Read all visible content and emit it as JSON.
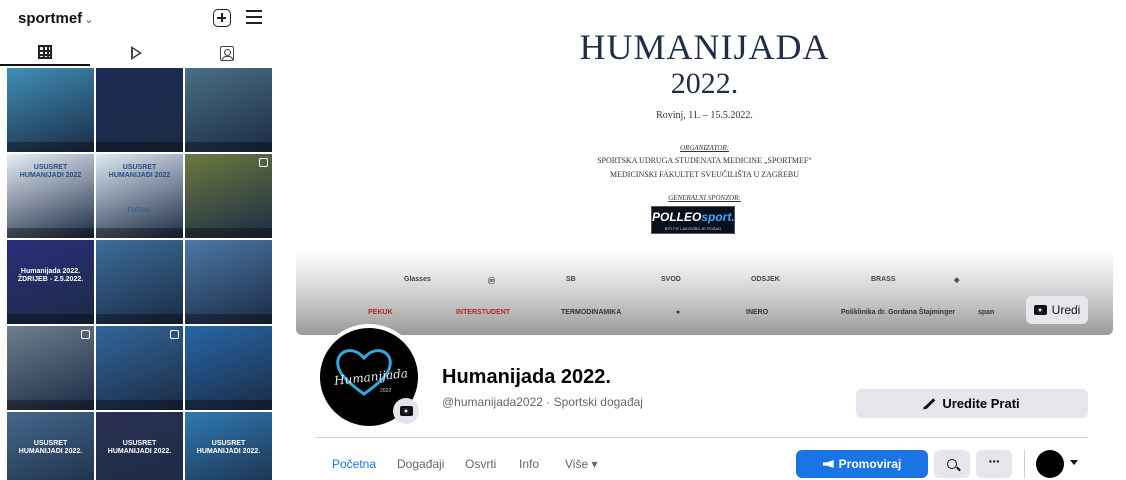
{
  "instagram": {
    "username": "sportmef",
    "username_chevron": "⌄",
    "tiles": [
      {
        "caption": "",
        "bg": "#3f8fb8"
      },
      {
        "caption": "",
        "bg": "#1d2a55"
      },
      {
        "caption": "",
        "bg": "#4a6f84"
      },
      {
        "caption": "USUSRET HUMANIJADI 2022",
        "bg": "#e8eef6"
      },
      {
        "caption": "USUSRET HUMANIJADI 2022",
        "sub": "FUTSAL",
        "bg": "#dfe9f4"
      },
      {
        "caption": "",
        "bg": "#6b7a3e"
      },
      {
        "caption": "Humanijada 2022. ŽDRIJEB - 2.5.2022.",
        "bg": "#2b2d7a"
      },
      {
        "caption": "",
        "bg": "#3c6d9a"
      },
      {
        "caption": "",
        "bg": "#4c78a6"
      },
      {
        "caption": "",
        "bg": "#6e7f8e"
      },
      {
        "caption": "",
        "bg": "#32669a"
      },
      {
        "caption": "",
        "bg": "#2766a8"
      },
      {
        "caption": "USUSRET HUMANIJADI 2022.",
        "bg": "#44688c"
      },
      {
        "caption": "USUSRET HUMANIJADI 2022.",
        "bg": "#2a2f52"
      },
      {
        "caption": "USUSRET HUMANIJADI 2022.",
        "bg": "#2f7ab2"
      }
    ]
  },
  "cover": {
    "title": "HUMANIJADA",
    "year": "2022.",
    "place_date": "Rovinj, 11. – 15.5.2022.",
    "organizer_label": "ORGANIZATOR:",
    "organizer_line1": "SPORTSKA UDRUGA STUDENATA MEDICINE „SPORTMEF“",
    "organizer_line2": "MEDICINSKI FAKULTET SVEUČILIŠTA U ZAGREBU",
    "sponsor_label": "GENERALNI SPONZOR:",
    "sponsor_logo_a": "POLLEO",
    "sponsor_logo_b": "sport.",
    "sponsor_tagline": "BITI FIT LAKOVSKI JE POSAO",
    "logos_row1": [
      "Glasses",
      "ⓜ",
      "SB",
      "SVOD",
      "ODSJEK",
      "BRASS",
      "◈"
    ],
    "logos_row2": [
      "PEKUK",
      "INTERSTUDENT",
      "TERMODINAMIKA",
      "●",
      "INERO",
      "Poliklinika dr. Gordana Štajminger",
      "span"
    ],
    "edit_label": "Uredi"
  },
  "profile": {
    "avatar_word": "Humanijada",
    "avatar_year": "2022",
    "name": "Humanijada 2022.",
    "subtitle": "@humanijada2022 · Sportski događaj",
    "follow_label": "Uredite Prati"
  },
  "nav": {
    "items": [
      "Početna",
      "Događaji",
      "Osvrti",
      "Info",
      "Više ▾"
    ],
    "promote_label": "Promoviraj",
    "more_dots": "···"
  },
  "colors": {
    "accent": "#1b74e4",
    "button_gray": "#e4e6eb",
    "cover_title": "#1f2d4a"
  }
}
